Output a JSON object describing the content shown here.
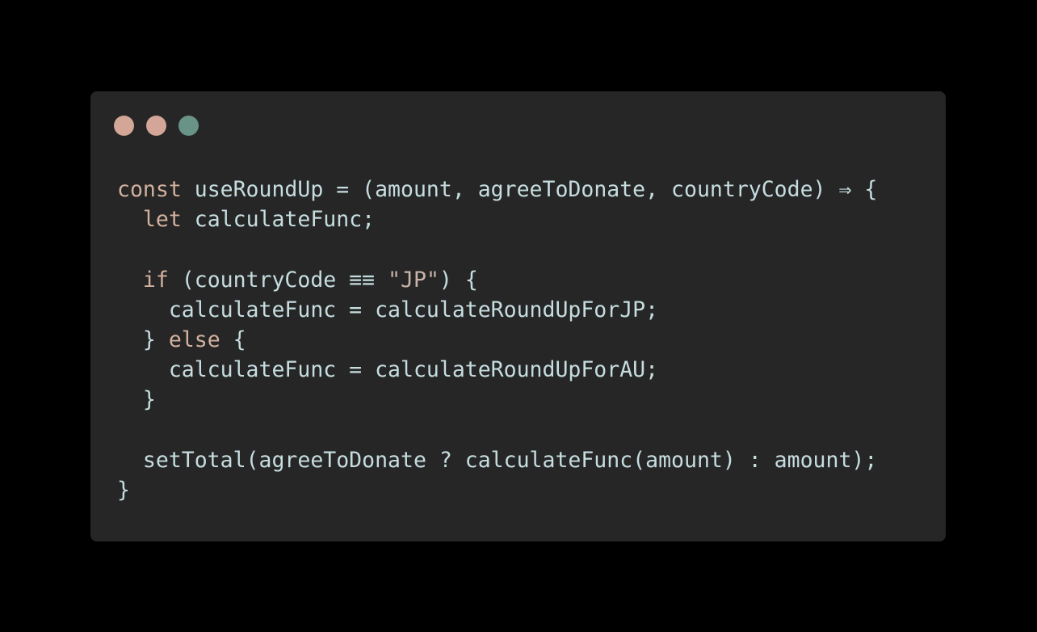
{
  "window": {
    "dots": [
      {
        "name": "close-dot",
        "color": "#d3a698"
      },
      {
        "name": "minimize-dot",
        "color": "#d3a698"
      },
      {
        "name": "zoom-dot",
        "color": "#6a9387"
      }
    ]
  },
  "code": {
    "lines": [
      [
        {
          "t": "const",
          "k": "keyword"
        },
        {
          "t": " useRoundUp = (amount, agreeToDonate, countryCode) ⇒ {",
          "k": "plain"
        }
      ],
      [
        {
          "t": "  ",
          "k": "plain"
        },
        {
          "t": "let",
          "k": "keyword"
        },
        {
          "t": " calculateFunc;",
          "k": "plain"
        }
      ],
      [],
      [
        {
          "t": "  ",
          "k": "plain"
        },
        {
          "t": "if",
          "k": "keyword"
        },
        {
          "t": " (countryCode ≡≡ ",
          "k": "plain"
        },
        {
          "t": "\"JP\"",
          "k": "string"
        },
        {
          "t": ") {",
          "k": "plain"
        }
      ],
      [
        {
          "t": "    calculateFunc = calculateRoundUpForJP;",
          "k": "plain"
        }
      ],
      [
        {
          "t": "  } ",
          "k": "plain"
        },
        {
          "t": "else",
          "k": "keyword"
        },
        {
          "t": " {",
          "k": "plain"
        }
      ],
      [
        {
          "t": "    calculateFunc = calculateRoundUpForAU;",
          "k": "plain"
        }
      ],
      [
        {
          "t": "  }",
          "k": "plain"
        }
      ],
      [],
      [
        {
          "t": "  setTotal(agreeToDonate ? calculateFunc(amount) : amount);",
          "k": "plain"
        }
      ],
      [
        {
          "t": "}",
          "k": "plain"
        }
      ]
    ]
  }
}
